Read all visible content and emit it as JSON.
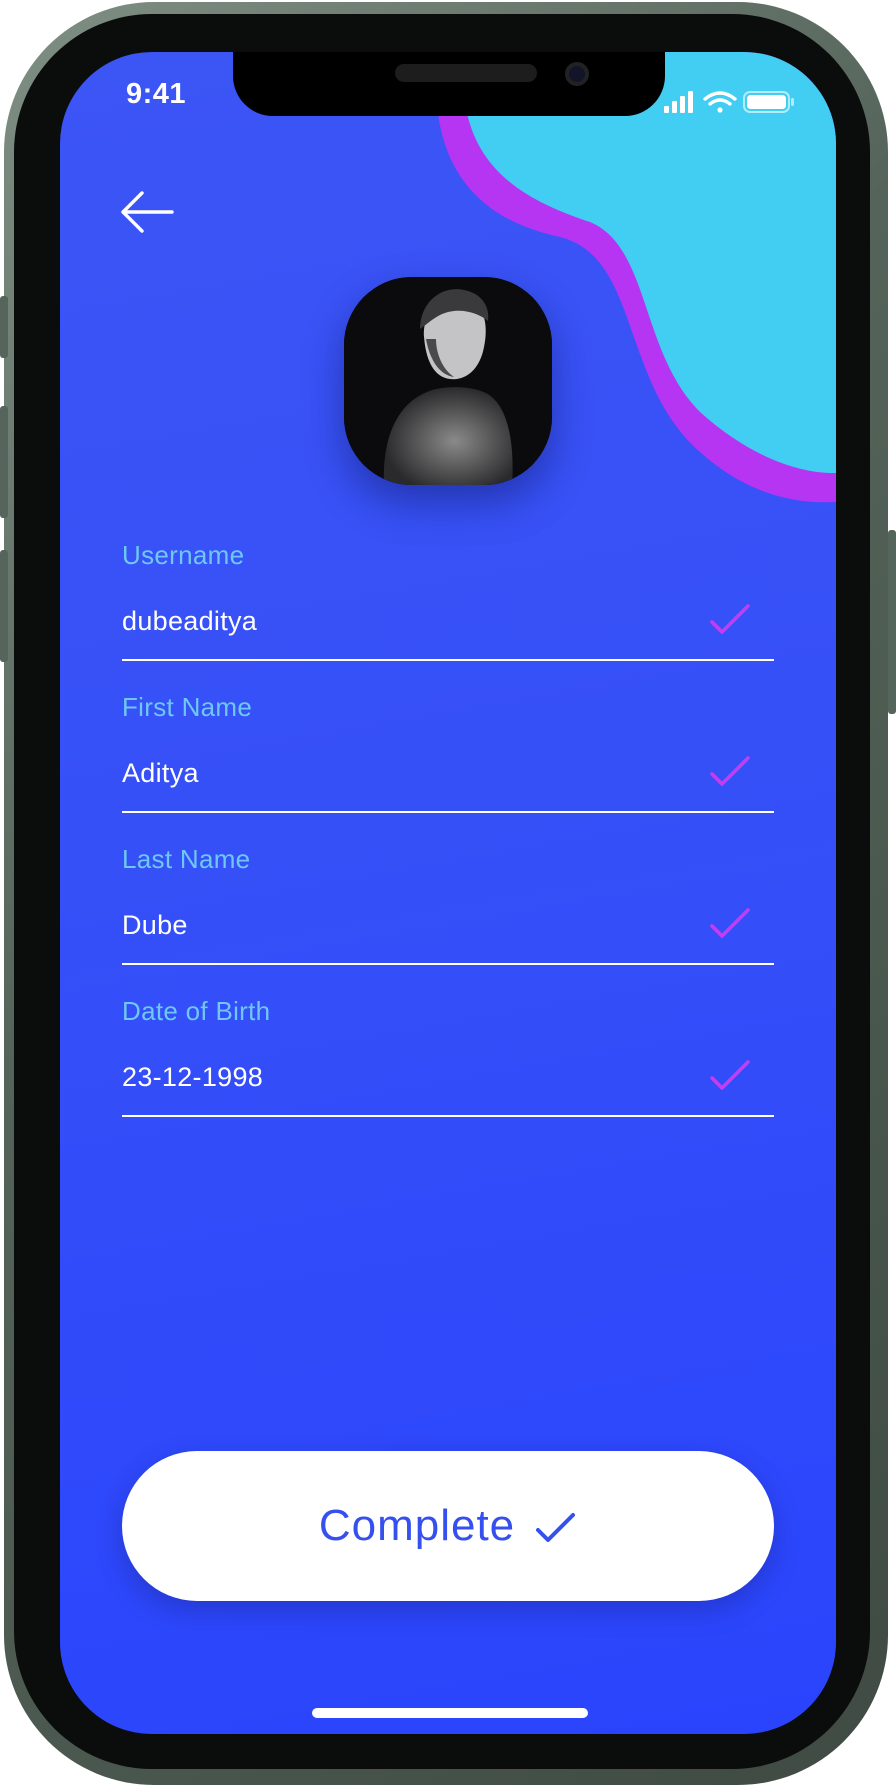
{
  "status_bar": {
    "time": "9:41",
    "signal_icon": "cellular-signal-icon",
    "wifi_icon": "wifi-icon",
    "battery_icon": "battery-icon"
  },
  "header": {
    "back_icon": "arrow-left-icon"
  },
  "profile": {
    "avatar_icon": "profile-photo"
  },
  "form": {
    "fields": [
      {
        "label": "Username",
        "value": "dubeaditya",
        "valid": true
      },
      {
        "label": "First Name",
        "value": "Aditya",
        "valid": true
      },
      {
        "label": "Last Name",
        "value": "Dube",
        "valid": true
      },
      {
        "label": "Date of Birth",
        "value": "23-12-1998",
        "valid": true
      }
    ]
  },
  "actions": {
    "complete_label": "Complete",
    "complete_icon": "checkmark-icon"
  },
  "colors": {
    "background": "#3650f8",
    "label": "#6ec8f3",
    "check": "#c23ef0",
    "blob_purple": "#b535f2",
    "blob_cyan": "#42cdf2",
    "button_text": "#3650f0"
  }
}
